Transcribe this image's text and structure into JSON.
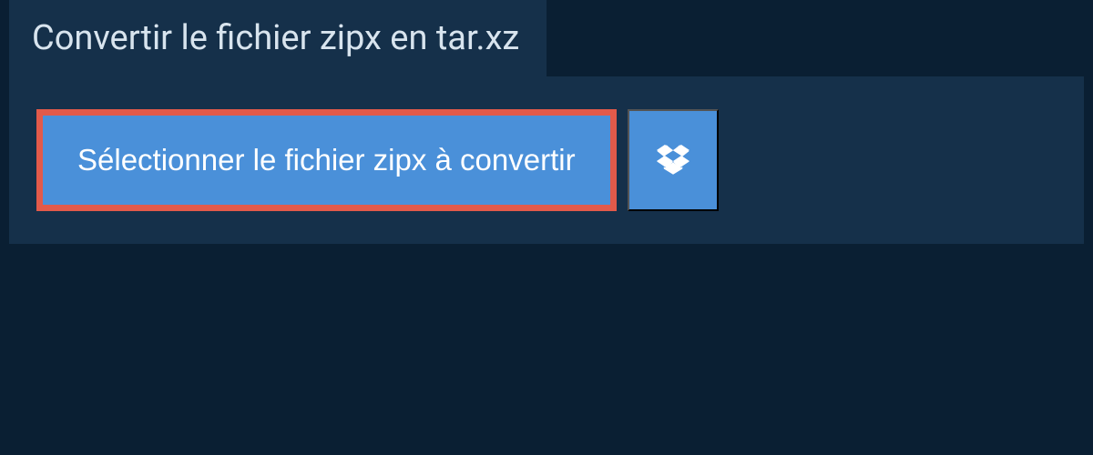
{
  "header": {
    "title": "Convertir le fichier zipx en tar.xz"
  },
  "actions": {
    "select_file_label": "Sélectionner le fichier zipx à convertir"
  },
  "colors": {
    "background": "#0a1f33",
    "panel": "#15304a",
    "button": "#4a90d9",
    "highlight_border": "#e25a4a",
    "text_light": "#d8e4ee"
  }
}
